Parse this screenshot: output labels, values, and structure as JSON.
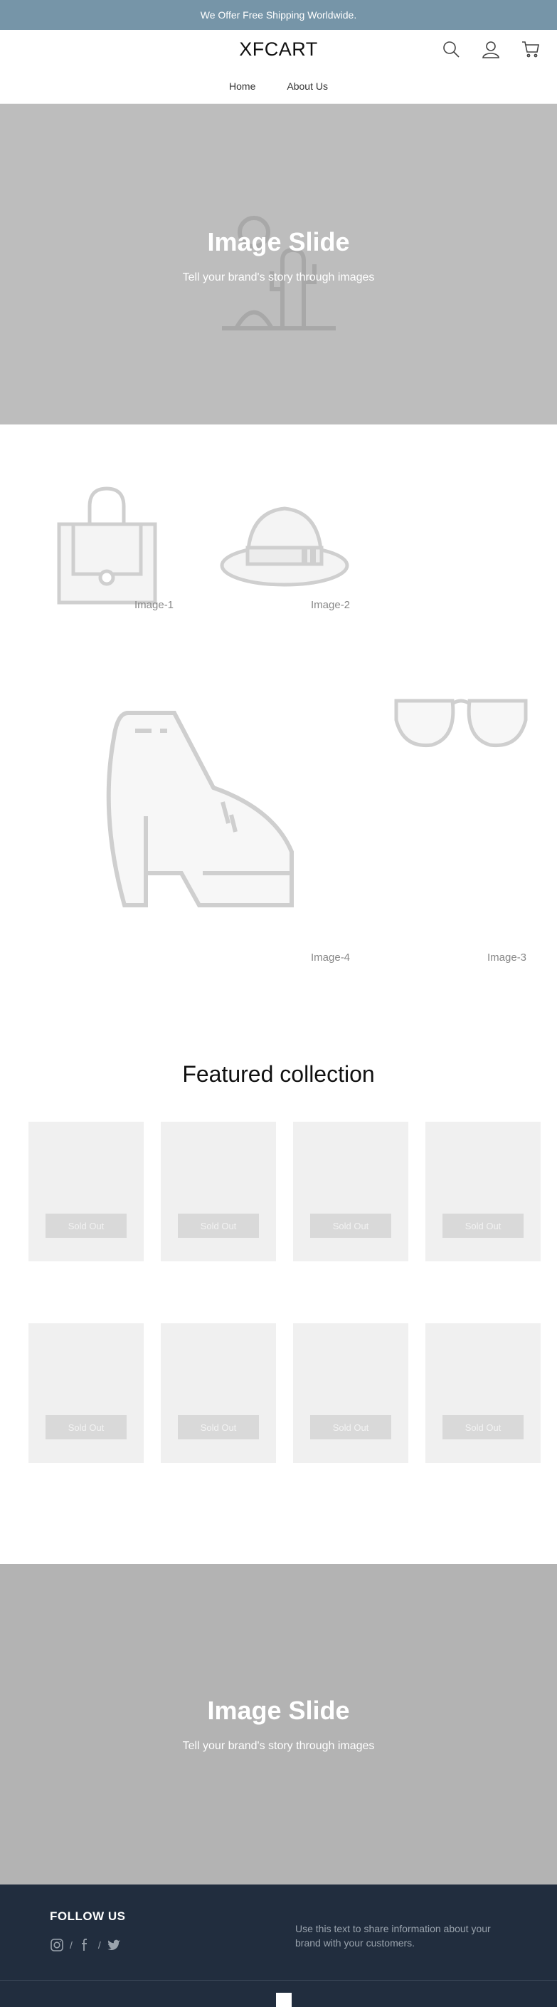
{
  "announcement": {
    "text": "We Offer Free Shipping Worldwide."
  },
  "header": {
    "logo": "XFCART",
    "icons": [
      "search-icon",
      "user-icon",
      "cart-icon"
    ]
  },
  "nav": {
    "items": [
      {
        "label": "Home"
      },
      {
        "label": "About Us"
      }
    ]
  },
  "hero": {
    "title": "Image Slide",
    "subtitle": "Tell your brand's story through images"
  },
  "gallery": {
    "captions": [
      "Image-1",
      "Image-2",
      "Image-4",
      "Image-3"
    ],
    "icons": [
      "handbag-icon",
      "hat-icon",
      "boot-icon",
      "sunglasses-icon"
    ]
  },
  "featured": {
    "title": "Featured collection",
    "products": [
      {
        "badge": "Sold Out"
      },
      {
        "badge": "Sold Out"
      },
      {
        "badge": "Sold Out"
      },
      {
        "badge": "Sold Out"
      },
      {
        "badge": "Sold Out"
      },
      {
        "badge": "Sold Out"
      },
      {
        "badge": "Sold Out"
      },
      {
        "badge": "Sold Out"
      }
    ]
  },
  "hero2": {
    "title": "Image Slide",
    "subtitle": "Tell your brand's story through images"
  },
  "footer": {
    "follow_title": "FOLLOW US",
    "social_separator": "/",
    "socials": [
      "instagram-icon",
      "facebook-icon",
      "twitter-icon"
    ],
    "text": "Use this text to share information about your brand with your customers."
  },
  "colors": {
    "announcement_bg": "#7695a8",
    "hero_bg": "#bdbdbd",
    "footer_bg": "#212d3e",
    "card_bg": "#f0f0f0",
    "badge_bg": "#d9d9d9"
  }
}
